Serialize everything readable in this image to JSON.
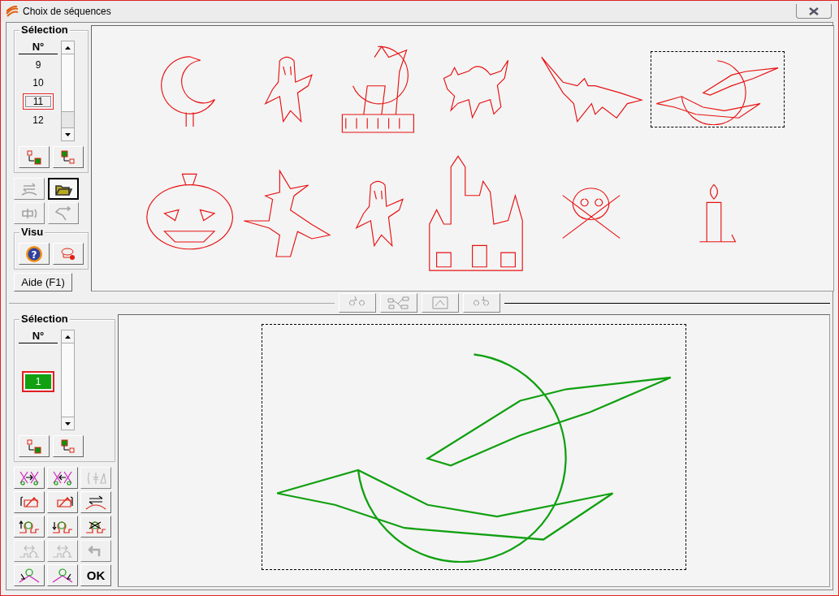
{
  "window": {
    "title": "Choix de séquences"
  },
  "top_panel": {
    "group_title": "Sélection",
    "column_header": "N°",
    "items": [
      {
        "label": "9",
        "selected": false
      },
      {
        "label": "10",
        "selected": false
      },
      {
        "label": "11",
        "selected": true
      },
      {
        "label": "12",
        "selected": false
      }
    ],
    "move_buttons": [
      {
        "kind": "to-selected",
        "disabled": false
      },
      {
        "kind": "from-selected",
        "disabled": false
      }
    ],
    "tools": [
      {
        "kind": "swap",
        "disabled": true
      },
      {
        "kind": "folder",
        "disabled": false
      },
      {
        "kind": "rotate",
        "disabled": true
      },
      {
        "kind": "path",
        "disabled": true
      }
    ],
    "visu_title": "Visu",
    "visu_buttons": [
      {
        "kind": "help",
        "disabled": false,
        "label": "?"
      },
      {
        "kind": "lasso",
        "disabled": false
      }
    ],
    "help_button": "Aide (F1)"
  },
  "top_canvas": {
    "shapes": [
      {
        "kind": "moon",
        "selected": false
      },
      {
        "kind": "ghost",
        "selected": false
      },
      {
        "kind": "cat-fence",
        "selected": false
      },
      {
        "kind": "cat",
        "selected": false
      },
      {
        "kind": "bat",
        "selected": false
      },
      {
        "kind": "bat-moon",
        "selected": true
      },
      {
        "kind": "pumpkin",
        "selected": false
      },
      {
        "kind": "witch",
        "selected": false
      },
      {
        "kind": "ghost",
        "selected": false
      },
      {
        "kind": "castle",
        "selected": false
      },
      {
        "kind": "skull",
        "selected": false
      },
      {
        "kind": "candle",
        "selected": false
      }
    ]
  },
  "middle_toolbar": [
    {
      "kind": "up",
      "disabled": true
    },
    {
      "kind": "network",
      "disabled": true
    },
    {
      "kind": "frame",
      "disabled": true
    },
    {
      "kind": "down",
      "disabled": true
    }
  ],
  "bottom_panel": {
    "group_title": "Sélection",
    "column_header": "N°",
    "items": [
      {
        "label": "1",
        "selected": true
      }
    ],
    "move_buttons": [
      {
        "kind": "to-selected",
        "disabled": false
      },
      {
        "kind": "from-selected",
        "disabled": false
      }
    ],
    "tools": [
      {
        "kind": "cut-right",
        "disabled": false
      },
      {
        "kind": "cut-left",
        "disabled": false
      },
      {
        "kind": "split",
        "disabled": true
      },
      {
        "kind": "rot-left",
        "disabled": false
      },
      {
        "kind": "rot-right",
        "disabled": false
      },
      {
        "kind": "flip",
        "disabled": false
      },
      {
        "kind": "loop-up",
        "disabled": false
      },
      {
        "kind": "loop-down",
        "disabled": false
      },
      {
        "kind": "cross",
        "disabled": false
      },
      {
        "kind": "spread",
        "disabled": true
      },
      {
        "kind": "join",
        "disabled": true
      },
      {
        "kind": "undo",
        "disabled": true
      },
      {
        "kind": "node-left",
        "disabled": false
      },
      {
        "kind": "node-right",
        "disabled": false
      }
    ],
    "ok_button": "OK"
  },
  "bottom_canvas": {
    "shape": {
      "kind": "bat-moon",
      "selected": true
    }
  }
}
